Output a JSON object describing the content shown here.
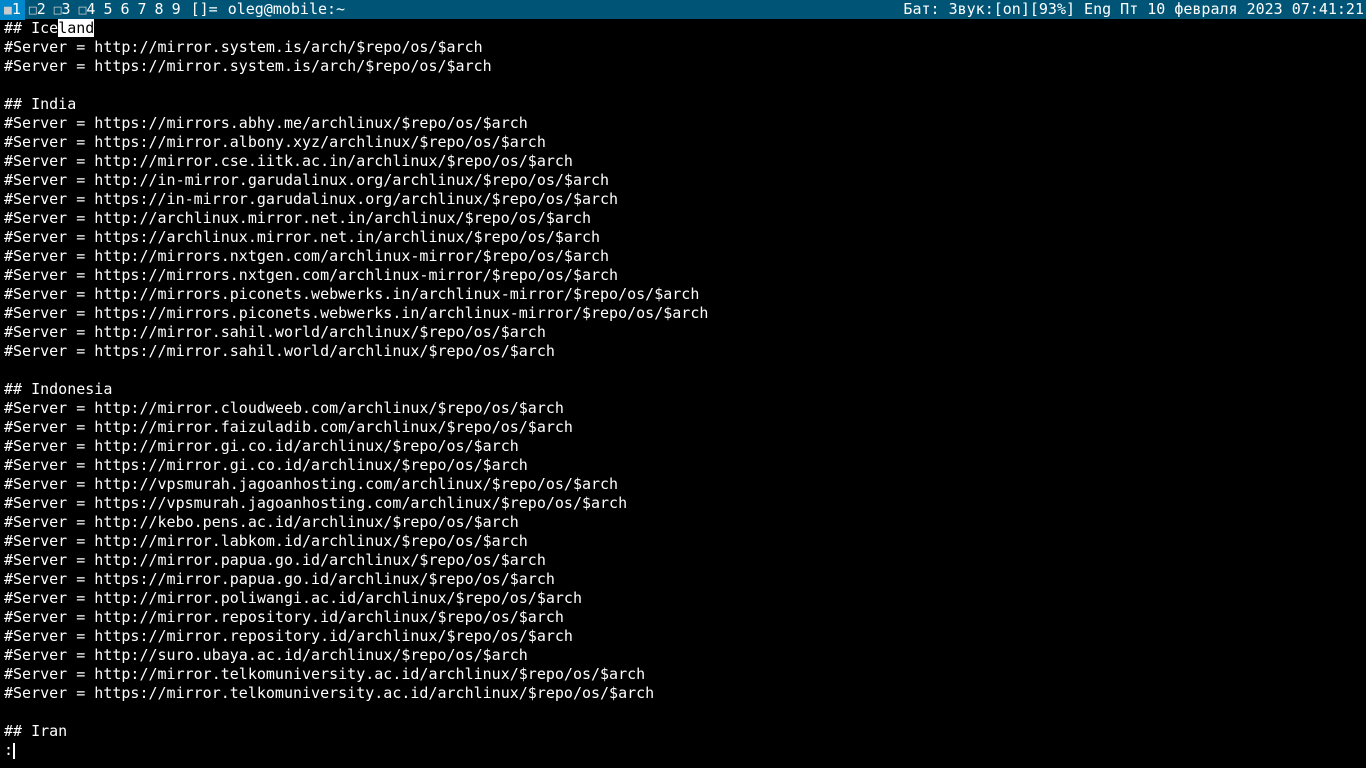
{
  "statusbar": {
    "workspaces": [
      {
        "ind": "■",
        "num": "1"
      },
      {
        "ind": "□",
        "num": "2"
      },
      {
        "ind": "□",
        "num": "3"
      },
      {
        "ind": "□",
        "num": "4"
      },
      {
        "ind": "",
        "num": "5"
      },
      {
        "ind": "",
        "num": "6"
      },
      {
        "ind": "",
        "num": "7"
      },
      {
        "ind": "",
        "num": "8"
      },
      {
        "ind": "",
        "num": "9"
      }
    ],
    "layout": "[]=",
    "title": "oleg@mobile:~",
    "sysinfo": "Бат: Звук:[on][93%] Eng Пт 10 февраля 2023 07:41:21"
  },
  "terminal": {
    "lines": [
      {
        "pre": "## Ice",
        "sel": "land",
        "post": ""
      },
      "#Server = http://mirror.system.is/arch/$repo/os/$arch",
      "#Server = https://mirror.system.is/arch/$repo/os/$arch",
      "",
      "## India",
      "#Server = https://mirrors.abhy.me/archlinux/$repo/os/$arch",
      "#Server = https://mirror.albony.xyz/archlinux/$repo/os/$arch",
      "#Server = http://mirror.cse.iitk.ac.in/archlinux/$repo/os/$arch",
      "#Server = http://in-mirror.garudalinux.org/archlinux/$repo/os/$arch",
      "#Server = https://in-mirror.garudalinux.org/archlinux/$repo/os/$arch",
      "#Server = http://archlinux.mirror.net.in/archlinux/$repo/os/$arch",
      "#Server = https://archlinux.mirror.net.in/archlinux/$repo/os/$arch",
      "#Server = http://mirrors.nxtgen.com/archlinux-mirror/$repo/os/$arch",
      "#Server = https://mirrors.nxtgen.com/archlinux-mirror/$repo/os/$arch",
      "#Server = http://mirrors.piconets.webwerks.in/archlinux-mirror/$repo/os/$arch",
      "#Server = https://mirrors.piconets.webwerks.in/archlinux-mirror/$repo/os/$arch",
      "#Server = http://mirror.sahil.world/archlinux/$repo/os/$arch",
      "#Server = https://mirror.sahil.world/archlinux/$repo/os/$arch",
      "",
      "## Indonesia",
      "#Server = http://mirror.cloudweeb.com/archlinux/$repo/os/$arch",
      "#Server = http://mirror.faizuladib.com/archlinux/$repo/os/$arch",
      "#Server = http://mirror.gi.co.id/archlinux/$repo/os/$arch",
      "#Server = https://mirror.gi.co.id/archlinux/$repo/os/$arch",
      "#Server = http://vpsmurah.jagoanhosting.com/archlinux/$repo/os/$arch",
      "#Server = https://vpsmurah.jagoanhosting.com/archlinux/$repo/os/$arch",
      "#Server = http://kebo.pens.ac.id/archlinux/$repo/os/$arch",
      "#Server = http://mirror.labkom.id/archlinux/$repo/os/$arch",
      "#Server = http://mirror.papua.go.id/archlinux/$repo/os/$arch",
      "#Server = https://mirror.papua.go.id/archlinux/$repo/os/$arch",
      "#Server = http://mirror.poliwangi.ac.id/archlinux/$repo/os/$arch",
      "#Server = http://mirror.repository.id/archlinux/$repo/os/$arch",
      "#Server = https://mirror.repository.id/archlinux/$repo/os/$arch",
      "#Server = http://suro.ubaya.ac.id/archlinux/$repo/os/$arch",
      "#Server = http://mirror.telkomuniversity.ac.id/archlinux/$repo/os/$arch",
      "#Server = https://mirror.telkomuniversity.ac.id/archlinux/$repo/os/$arch",
      "",
      "## Iran"
    ],
    "prompt": ":"
  }
}
